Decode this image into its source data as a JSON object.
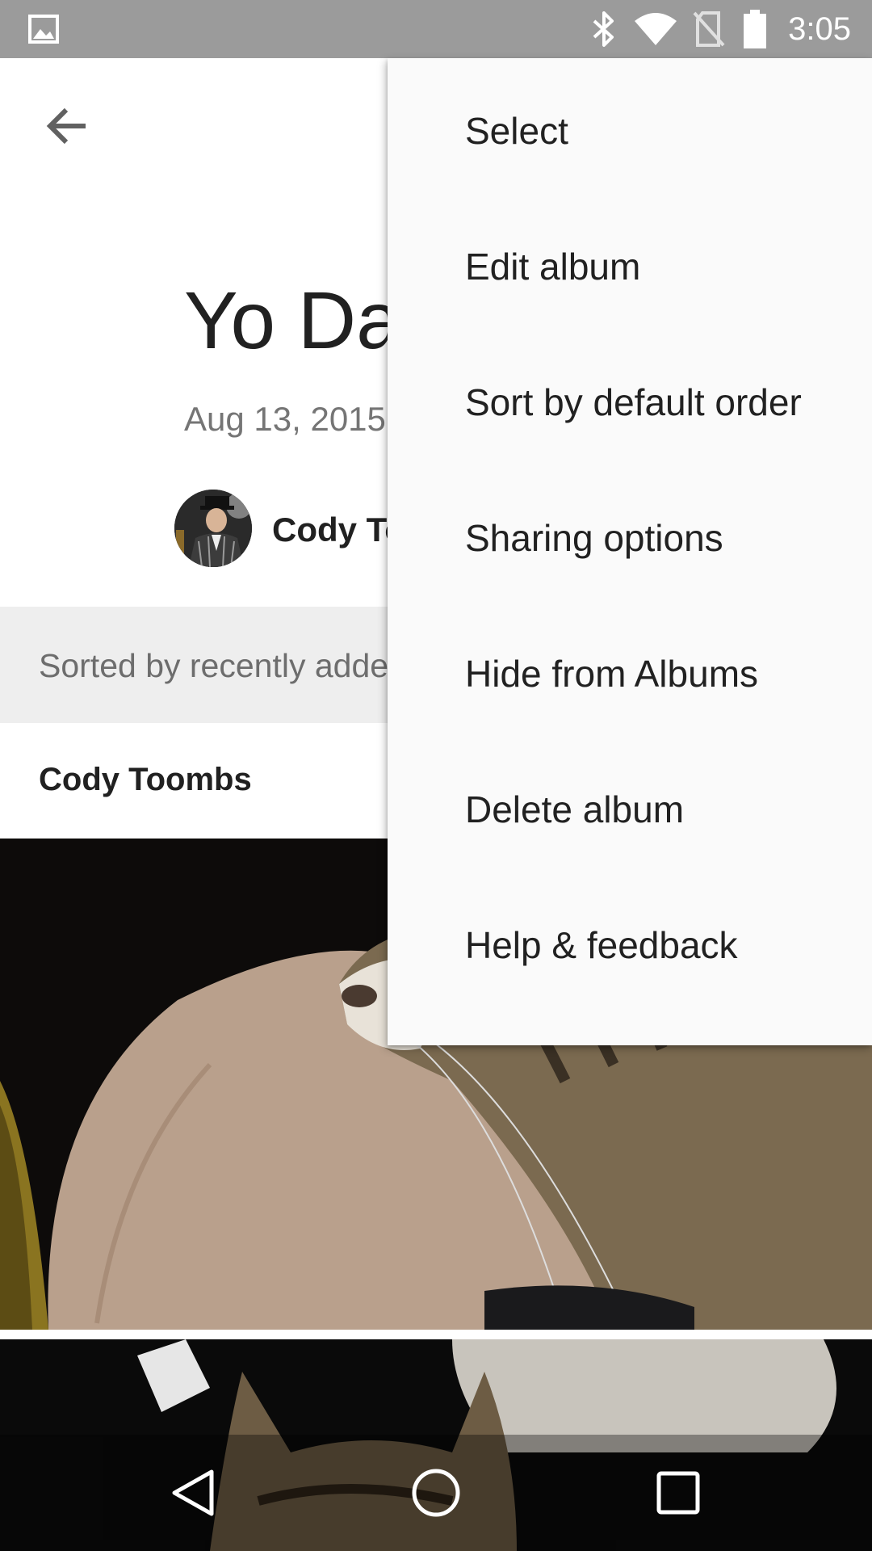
{
  "status_bar": {
    "time": "3:05",
    "icons": [
      "image-notification-icon",
      "bluetooth-icon",
      "wifi-icon",
      "no-sim-icon",
      "battery-icon"
    ]
  },
  "app_bar": {
    "back_icon": "arrow-back-icon"
  },
  "album": {
    "title": "Yo Dawg",
    "date": "Aug 13, 2015",
    "owner_name": "Cody Toombs",
    "sort_label": "Sorted by recently added",
    "contributor": "Cody Toombs"
  },
  "menu": {
    "items": [
      {
        "label": "Select"
      },
      {
        "label": "Edit album"
      },
      {
        "label": "Sort by default order"
      },
      {
        "label": "Sharing options"
      },
      {
        "label": "Hide from Albums"
      },
      {
        "label": "Delete album"
      },
      {
        "label": "Help & feedback"
      }
    ]
  },
  "nav_bar": {
    "icons": [
      "back-triangle-icon",
      "home-circle-icon",
      "recents-square-icon"
    ]
  },
  "colors": {
    "status_bar": "#9b9b9b",
    "menu_background": "#fafafa",
    "sort_band": "#eeeeee",
    "primary_text": "#212121",
    "secondary_text": "#757575"
  }
}
